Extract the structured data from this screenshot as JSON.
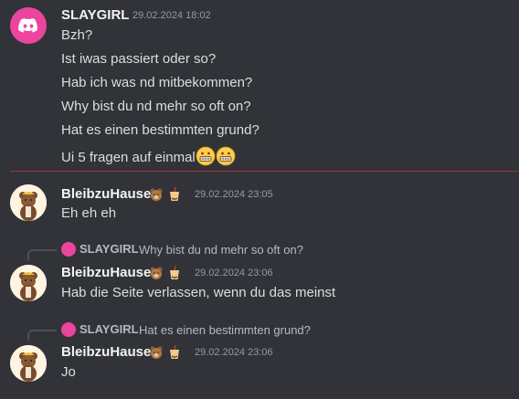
{
  "colors": {
    "background": "#313338",
    "discord_pink": "#eb459e",
    "new_messages_line": "#a1333b"
  },
  "messages": [
    {
      "author": "SLAYGIRL",
      "timestamp": "29.02.2024 18:02",
      "avatar_icon": "discord-logo-icon",
      "lines": [
        "Bzh?",
        "Ist iwas passiert oder so?",
        "Hab ich was nd mitbekommen?",
        "Why bist du nd mehr so oft on?",
        "Hat es einen bestimmten grund?",
        "Ui 5 fragen auf einmal"
      ],
      "emojis": [
        "grimacing-emoji",
        "grimacing-emoji"
      ]
    },
    {
      "author": "BleibzuHause",
      "timestamp": "29.02.2024 23:05",
      "badges": [
        "bear-emoji",
        "bubble-tea-emoji"
      ],
      "lines": [
        "Eh eh eh"
      ]
    },
    {
      "author": "BleibzuHause",
      "timestamp": "29.02.2024 23:06",
      "badges": [
        "bear-emoji",
        "bubble-tea-emoji"
      ],
      "reply": {
        "author": "SLAYGIRL",
        "text": "Why bist du nd mehr so oft on?"
      },
      "lines": [
        "Hab die Seite verlassen, wenn du das meinst"
      ]
    },
    {
      "author": "BleibzuHause",
      "timestamp": "29.02.2024 23:06",
      "badges": [
        "bear-emoji",
        "bubble-tea-emoji"
      ],
      "reply": {
        "author": "SLAYGIRL",
        "text": "Hat es einen bestimmten grund?"
      },
      "lines": [
        "Jo"
      ]
    }
  ]
}
